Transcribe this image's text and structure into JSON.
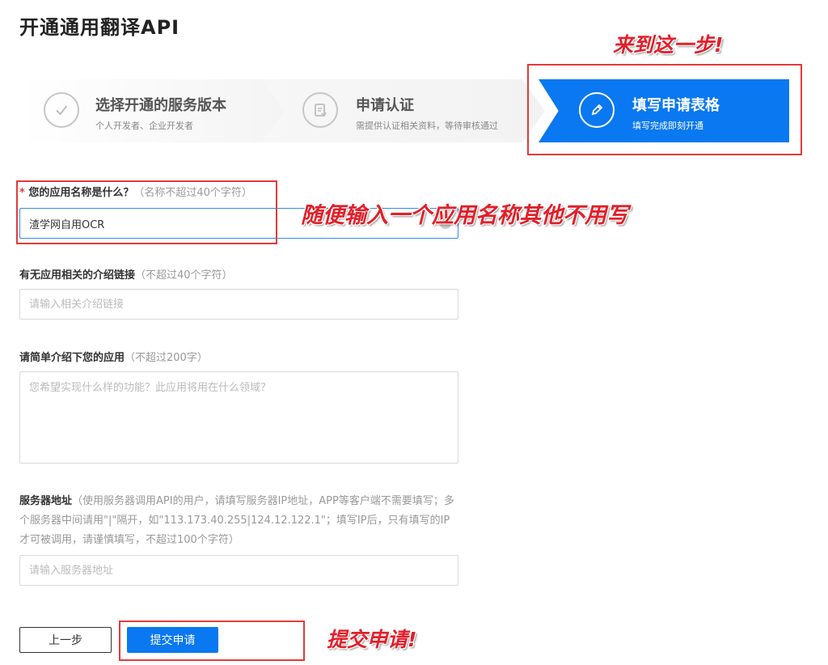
{
  "page_title": "开通通用翻译API",
  "steps": [
    {
      "title": "选择开通的服务版本",
      "subtitle": "个人开发者、企业开发者",
      "icon": "check-icon"
    },
    {
      "title": "申请认证",
      "subtitle": "需提供认证相关资料，等待审核通过",
      "icon": "document-icon"
    },
    {
      "title": "填写申请表格",
      "subtitle": "填写完成即刻开通",
      "icon": "pencil-icon"
    }
  ],
  "annotations": {
    "step": "来到这一步!",
    "name": "随便输入一个应用名称其他不用写",
    "submit": "提交申请!"
  },
  "form": {
    "app_name": {
      "required_mark": "*",
      "label": "您的应用名称是什么？",
      "hint": "（名称不超过40个字符）",
      "value": "渣学网自用OCR"
    },
    "link": {
      "label": "有无应用相关的介绍链接",
      "hint": "（不超过40个字符）",
      "placeholder": "请输入相关介绍链接"
    },
    "intro": {
      "label": "请简单介绍下您的应用",
      "hint": "（不超过200字）",
      "placeholder": "您希望实现什么样的功能？此应用将用在什么领域？"
    },
    "server": {
      "label": "服务器地址",
      "hint": "（使用服务器调用API的用户，请填写服务器IP地址，APP等客户端不需要填写；多个服务器中间请用\"|\"隔开，如\"113.173.40.255|124.12.122.1\"；填写IP后，只有填写的IP才可被调用，请谨慎填写，不超过100个字符）",
      "placeholder": "请输入服务器地址"
    }
  },
  "buttons": {
    "prev": "上一步",
    "submit": "提交申请"
  },
  "colors": {
    "primary": "#0a78f0",
    "annotation": "#e0202a"
  }
}
